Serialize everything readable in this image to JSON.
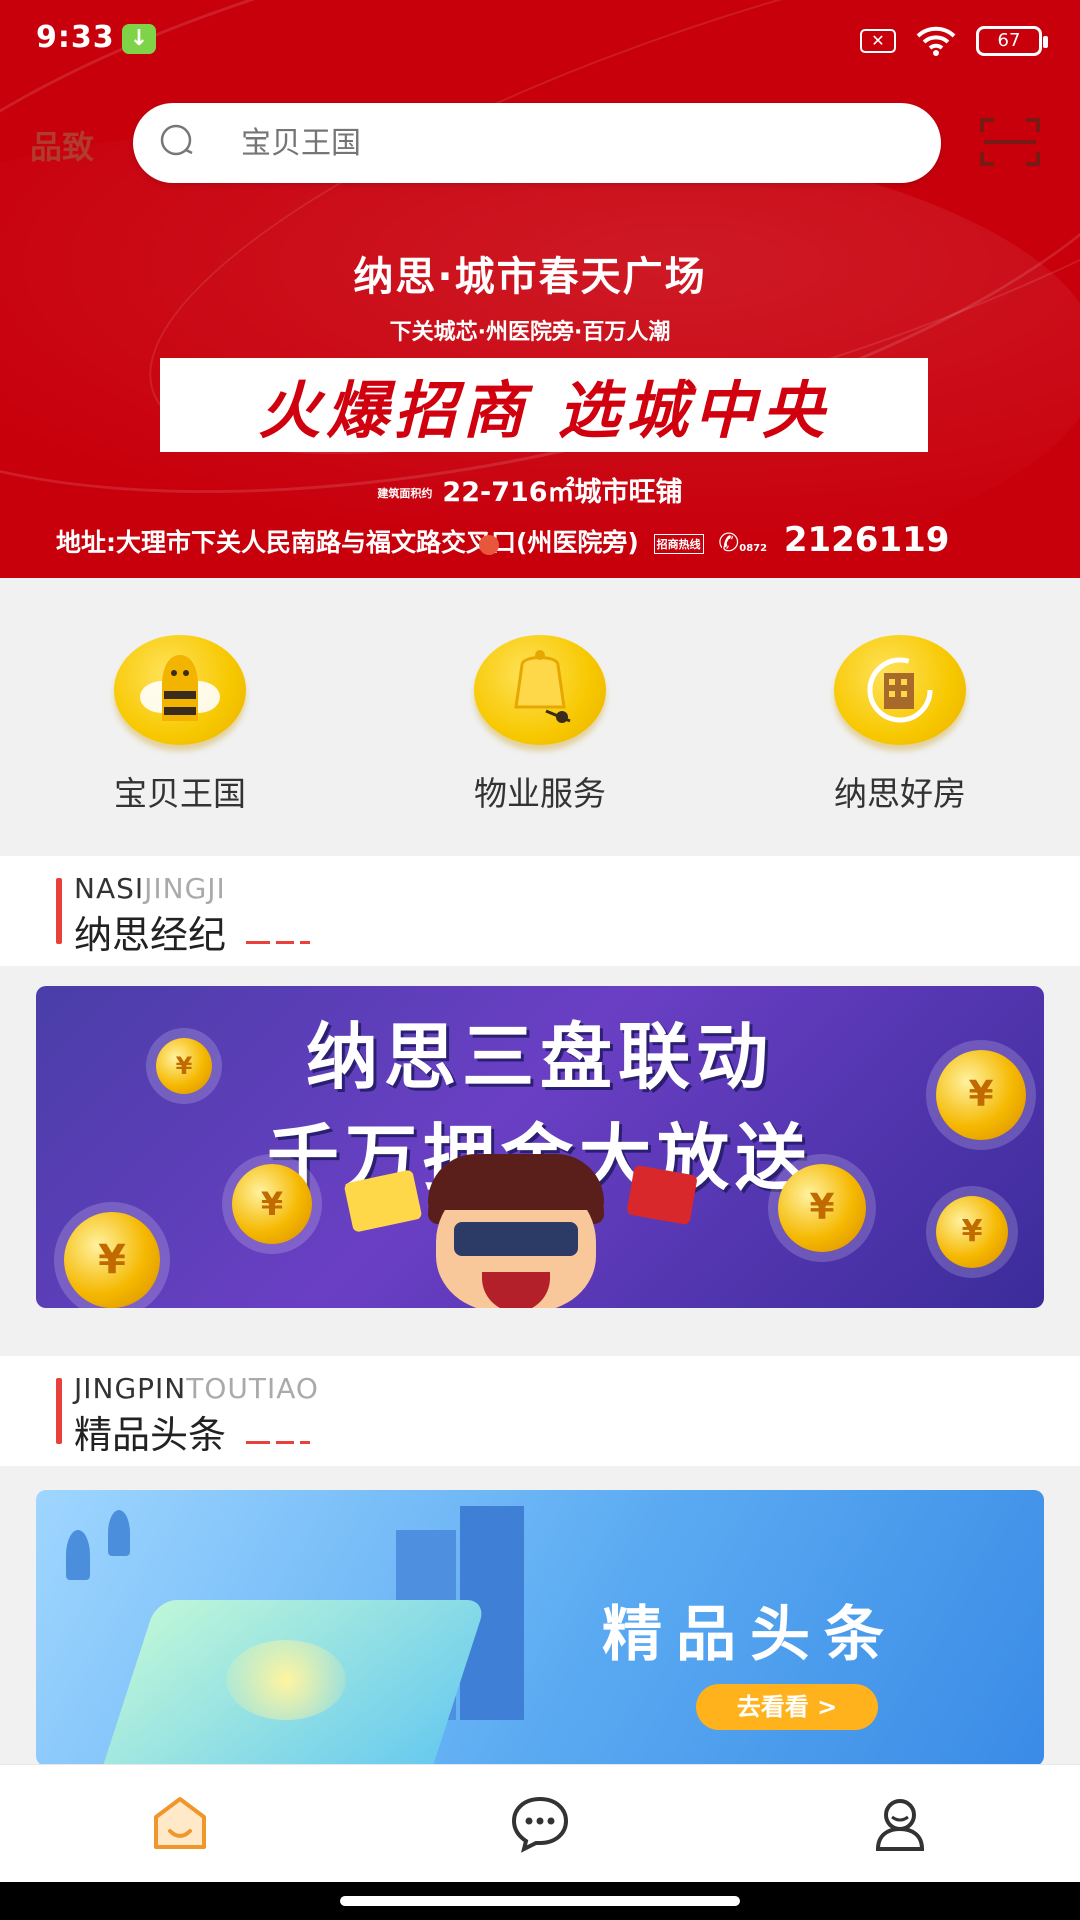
{
  "status_bar": {
    "time": "9:33",
    "battery": "67",
    "download_icon": "download-icon",
    "sim_icon": "no-sim-icon",
    "wifi_icon": "wifi-icon"
  },
  "header": {
    "city": "品致",
    "search_placeholder": "宝贝王国",
    "search_icon": "search-icon",
    "scan_icon": "scan-icon"
  },
  "hero_banner": {
    "title": "纳思·城市春天广场",
    "subtitle": "下关城芯·州医院旁·百万人潮",
    "headline": "火爆招商 选城中央",
    "area_tag": "建筑面积约",
    "area": "22-716㎡城市旺铺",
    "address": "地址:大理市下关人民南路与福文路交叉口(州医院旁)",
    "hotline_tag": "招商热线",
    "area_code": "0872",
    "phone": "2126119",
    "accent_color": "#c8000c"
  },
  "quick_menu": [
    {
      "label": "宝贝王国",
      "icon": "bee-icon"
    },
    {
      "label": "物业服务",
      "icon": "bell-icon"
    },
    {
      "label": "纳思好房",
      "icon": "house-icon"
    }
  ],
  "section_agency": {
    "en_dark": "NASI",
    "en_light": "JINGJI",
    "title": "纳思经纪"
  },
  "banner_agency": {
    "line1": "纳思三盘联动",
    "line2": "千万拥金大放送",
    "coin_symbol": "¥"
  },
  "section_news": {
    "en_dark": "JINGPIN",
    "en_light": "TOUTIAO",
    "title": "精品头条"
  },
  "banner_news": {
    "title": "精品头条",
    "button": "去看看 >"
  },
  "tabbar": [
    {
      "name": "home",
      "icon": "home-icon",
      "active": true,
      "color": "#f0962a"
    },
    {
      "name": "messages",
      "icon": "chat-icon",
      "active": false,
      "color": "#333333"
    },
    {
      "name": "profile",
      "icon": "user-icon",
      "active": false,
      "color": "#333333"
    }
  ]
}
